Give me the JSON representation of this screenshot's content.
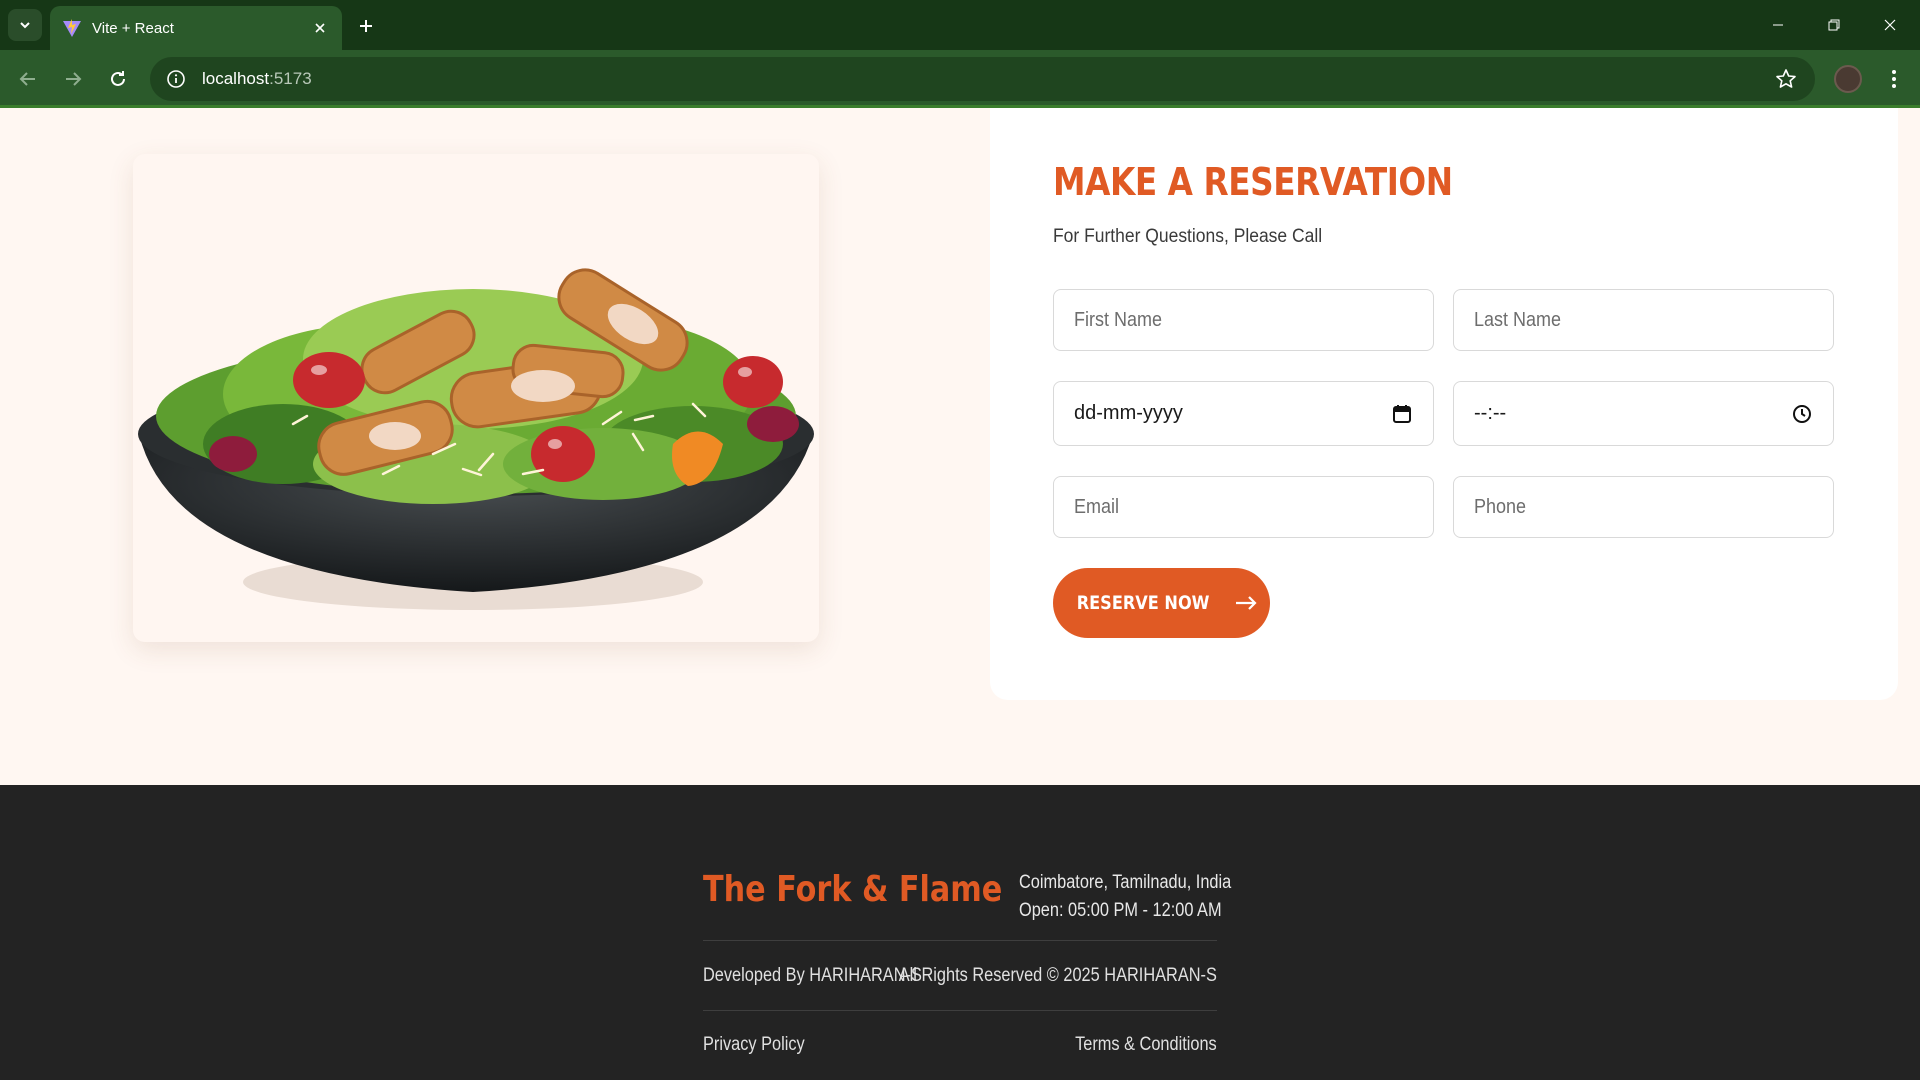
{
  "browser": {
    "tab_title": "Vite + React",
    "url_host": "localhost",
    "url_port": ":5173"
  },
  "reservation": {
    "title": "MAKE A RESERVATION",
    "subtitle": "For Further Questions, Please Call",
    "first_name_placeholder": "First Name",
    "last_name_placeholder": "Last Name",
    "date_value": "dd-mm-yyyy",
    "time_value": "--:--",
    "email_placeholder": "Email",
    "phone_placeholder": "Phone",
    "button_label": "RESERVE NOW"
  },
  "footer": {
    "brand": "The Fork & Flame",
    "address_line1": "Coimbatore, Tamilnadu, India",
    "address_line2": "Open: 05:00 PM - 12:00 AM",
    "developed_by": "Developed By HARIHARAN-S",
    "rights": "All Rights Reserved © 2025 HARIHARAN-S",
    "privacy_link": "Privacy Policy",
    "terms_link": "Terms & Conditions"
  },
  "colors": {
    "accent": "#e05a24",
    "page_bg": "#fff7f2",
    "footer_bg": "#232323",
    "browser_frame": "#163716",
    "browser_toolbar": "#2b5a2b"
  },
  "icons": {
    "tab_list": "chevron-down-icon",
    "favicon": "vite-logo-icon",
    "tab_close": "close-icon",
    "new_tab": "plus-icon",
    "back": "arrow-left-icon",
    "forward": "arrow-right-icon",
    "reload": "reload-icon",
    "site_info": "info-icon",
    "bookmark": "star-icon",
    "menu": "kebab-menu-icon",
    "date_picker": "calendar-icon",
    "time_picker": "clock-icon",
    "button_arrow": "arrow-right-icon"
  }
}
